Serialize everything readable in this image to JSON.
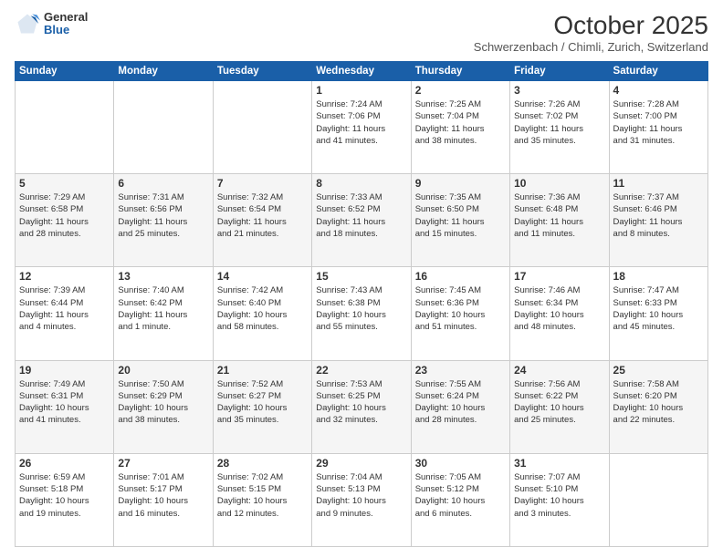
{
  "header": {
    "logo_general": "General",
    "logo_blue": "Blue",
    "month_title": "October 2025",
    "location": "Schwerzenbach / Chimli, Zurich, Switzerland"
  },
  "days_of_week": [
    "Sunday",
    "Monday",
    "Tuesday",
    "Wednesday",
    "Thursday",
    "Friday",
    "Saturday"
  ],
  "weeks": [
    {
      "shaded": false,
      "days": [
        {
          "num": "",
          "info": ""
        },
        {
          "num": "",
          "info": ""
        },
        {
          "num": "",
          "info": ""
        },
        {
          "num": "1",
          "info": "Sunrise: 7:24 AM\nSunset: 7:06 PM\nDaylight: 11 hours\nand 41 minutes."
        },
        {
          "num": "2",
          "info": "Sunrise: 7:25 AM\nSunset: 7:04 PM\nDaylight: 11 hours\nand 38 minutes."
        },
        {
          "num": "3",
          "info": "Sunrise: 7:26 AM\nSunset: 7:02 PM\nDaylight: 11 hours\nand 35 minutes."
        },
        {
          "num": "4",
          "info": "Sunrise: 7:28 AM\nSunset: 7:00 PM\nDaylight: 11 hours\nand 31 minutes."
        }
      ]
    },
    {
      "shaded": true,
      "days": [
        {
          "num": "5",
          "info": "Sunrise: 7:29 AM\nSunset: 6:58 PM\nDaylight: 11 hours\nand 28 minutes."
        },
        {
          "num": "6",
          "info": "Sunrise: 7:31 AM\nSunset: 6:56 PM\nDaylight: 11 hours\nand 25 minutes."
        },
        {
          "num": "7",
          "info": "Sunrise: 7:32 AM\nSunset: 6:54 PM\nDaylight: 11 hours\nand 21 minutes."
        },
        {
          "num": "8",
          "info": "Sunrise: 7:33 AM\nSunset: 6:52 PM\nDaylight: 11 hours\nand 18 minutes."
        },
        {
          "num": "9",
          "info": "Sunrise: 7:35 AM\nSunset: 6:50 PM\nDaylight: 11 hours\nand 15 minutes."
        },
        {
          "num": "10",
          "info": "Sunrise: 7:36 AM\nSunset: 6:48 PM\nDaylight: 11 hours\nand 11 minutes."
        },
        {
          "num": "11",
          "info": "Sunrise: 7:37 AM\nSunset: 6:46 PM\nDaylight: 11 hours\nand 8 minutes."
        }
      ]
    },
    {
      "shaded": false,
      "days": [
        {
          "num": "12",
          "info": "Sunrise: 7:39 AM\nSunset: 6:44 PM\nDaylight: 11 hours\nand 4 minutes."
        },
        {
          "num": "13",
          "info": "Sunrise: 7:40 AM\nSunset: 6:42 PM\nDaylight: 11 hours\nand 1 minute."
        },
        {
          "num": "14",
          "info": "Sunrise: 7:42 AM\nSunset: 6:40 PM\nDaylight: 10 hours\nand 58 minutes."
        },
        {
          "num": "15",
          "info": "Sunrise: 7:43 AM\nSunset: 6:38 PM\nDaylight: 10 hours\nand 55 minutes."
        },
        {
          "num": "16",
          "info": "Sunrise: 7:45 AM\nSunset: 6:36 PM\nDaylight: 10 hours\nand 51 minutes."
        },
        {
          "num": "17",
          "info": "Sunrise: 7:46 AM\nSunset: 6:34 PM\nDaylight: 10 hours\nand 48 minutes."
        },
        {
          "num": "18",
          "info": "Sunrise: 7:47 AM\nSunset: 6:33 PM\nDaylight: 10 hours\nand 45 minutes."
        }
      ]
    },
    {
      "shaded": true,
      "days": [
        {
          "num": "19",
          "info": "Sunrise: 7:49 AM\nSunset: 6:31 PM\nDaylight: 10 hours\nand 41 minutes."
        },
        {
          "num": "20",
          "info": "Sunrise: 7:50 AM\nSunset: 6:29 PM\nDaylight: 10 hours\nand 38 minutes."
        },
        {
          "num": "21",
          "info": "Sunrise: 7:52 AM\nSunset: 6:27 PM\nDaylight: 10 hours\nand 35 minutes."
        },
        {
          "num": "22",
          "info": "Sunrise: 7:53 AM\nSunset: 6:25 PM\nDaylight: 10 hours\nand 32 minutes."
        },
        {
          "num": "23",
          "info": "Sunrise: 7:55 AM\nSunset: 6:24 PM\nDaylight: 10 hours\nand 28 minutes."
        },
        {
          "num": "24",
          "info": "Sunrise: 7:56 AM\nSunset: 6:22 PM\nDaylight: 10 hours\nand 25 minutes."
        },
        {
          "num": "25",
          "info": "Sunrise: 7:58 AM\nSunset: 6:20 PM\nDaylight: 10 hours\nand 22 minutes."
        }
      ]
    },
    {
      "shaded": false,
      "days": [
        {
          "num": "26",
          "info": "Sunrise: 6:59 AM\nSunset: 5:18 PM\nDaylight: 10 hours\nand 19 minutes."
        },
        {
          "num": "27",
          "info": "Sunrise: 7:01 AM\nSunset: 5:17 PM\nDaylight: 10 hours\nand 16 minutes."
        },
        {
          "num": "28",
          "info": "Sunrise: 7:02 AM\nSunset: 5:15 PM\nDaylight: 10 hours\nand 12 minutes."
        },
        {
          "num": "29",
          "info": "Sunrise: 7:04 AM\nSunset: 5:13 PM\nDaylight: 10 hours\nand 9 minutes."
        },
        {
          "num": "30",
          "info": "Sunrise: 7:05 AM\nSunset: 5:12 PM\nDaylight: 10 hours\nand 6 minutes."
        },
        {
          "num": "31",
          "info": "Sunrise: 7:07 AM\nSunset: 5:10 PM\nDaylight: 10 hours\nand 3 minutes."
        },
        {
          "num": "",
          "info": ""
        }
      ]
    }
  ]
}
